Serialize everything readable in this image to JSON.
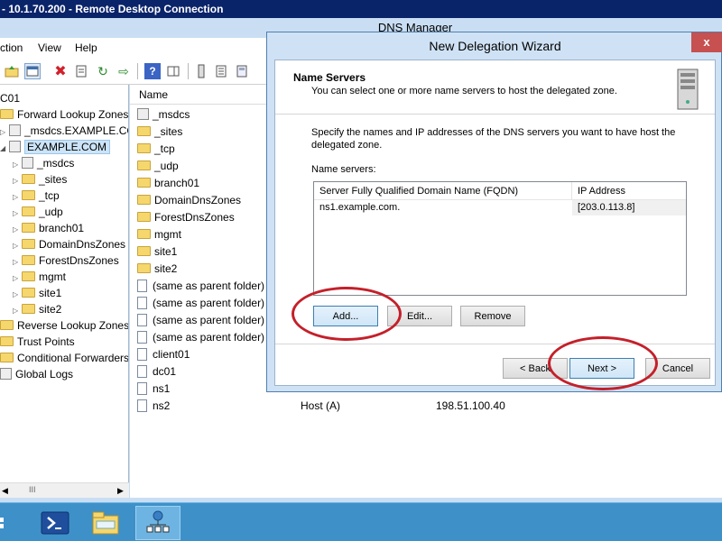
{
  "rdp": {
    "title": "- 10.1.70.200 - Remote Desktop Connection"
  },
  "app": {
    "title": "DNS Manager",
    "menu": [
      "ction",
      "View",
      "Help"
    ]
  },
  "tree": {
    "items": [
      {
        "label": "C01"
      },
      {
        "label": "Forward Lookup Zones"
      },
      {
        "label": "_msdcs.EXAMPLE.CC"
      },
      {
        "label": "EXAMPLE.COM"
      },
      {
        "label": "_msdcs"
      },
      {
        "label": "_sites"
      },
      {
        "label": "_tcp"
      },
      {
        "label": "_udp"
      },
      {
        "label": "branch01"
      },
      {
        "label": "DomainDnsZones"
      },
      {
        "label": "ForestDnsZones"
      },
      {
        "label": "mgmt"
      },
      {
        "label": "site1"
      },
      {
        "label": "site2"
      },
      {
        "label": "Reverse Lookup Zones"
      },
      {
        "label": "Trust Points"
      },
      {
        "label": "Conditional Forwarders"
      },
      {
        "label": "Global Logs"
      }
    ],
    "scroll_glyph": "III"
  },
  "list": {
    "header": "Name",
    "rows": [
      {
        "name": "_msdcs"
      },
      {
        "name": "_sites"
      },
      {
        "name": "_tcp"
      },
      {
        "name": "_udp"
      },
      {
        "name": "branch01"
      },
      {
        "name": "DomainDnsZones"
      },
      {
        "name": "ForestDnsZones"
      },
      {
        "name": "mgmt"
      },
      {
        "name": "site1"
      },
      {
        "name": "site2"
      },
      {
        "name": "(same as parent folder)"
      },
      {
        "name": "(same as parent folder)"
      },
      {
        "name": "(same as parent folder)"
      },
      {
        "name": "(same as parent folder)"
      },
      {
        "name": "client01"
      },
      {
        "name": "dc01"
      },
      {
        "name": "ns1"
      },
      {
        "name": "ns2",
        "type": "Host (A)",
        "data": "198.51.100.40"
      }
    ]
  },
  "wizard": {
    "title": "New Delegation Wizard",
    "close": "x",
    "heading": "Name Servers",
    "subheading": "You can select one or more name servers to host the delegated zone.",
    "instructions": "Specify the names and IP addresses of the DNS servers you want to have host the delegated zone.",
    "ns_label": "Name servers:",
    "table": {
      "col_fqdn": "Server Fully Qualified Domain Name (FQDN)",
      "col_ip": "IP Address",
      "rows": [
        {
          "fqdn": "ns1.example.com.",
          "ip": "[203.0.113.8]"
        }
      ]
    },
    "buttons": {
      "add": "Add...",
      "edit": "Edit...",
      "remove": "Remove",
      "back": "< Back",
      "next": "Next >",
      "cancel": "Cancel"
    }
  },
  "colors": {
    "annotation_circle": "#c4202a",
    "taskbar": "#3d91c8"
  }
}
